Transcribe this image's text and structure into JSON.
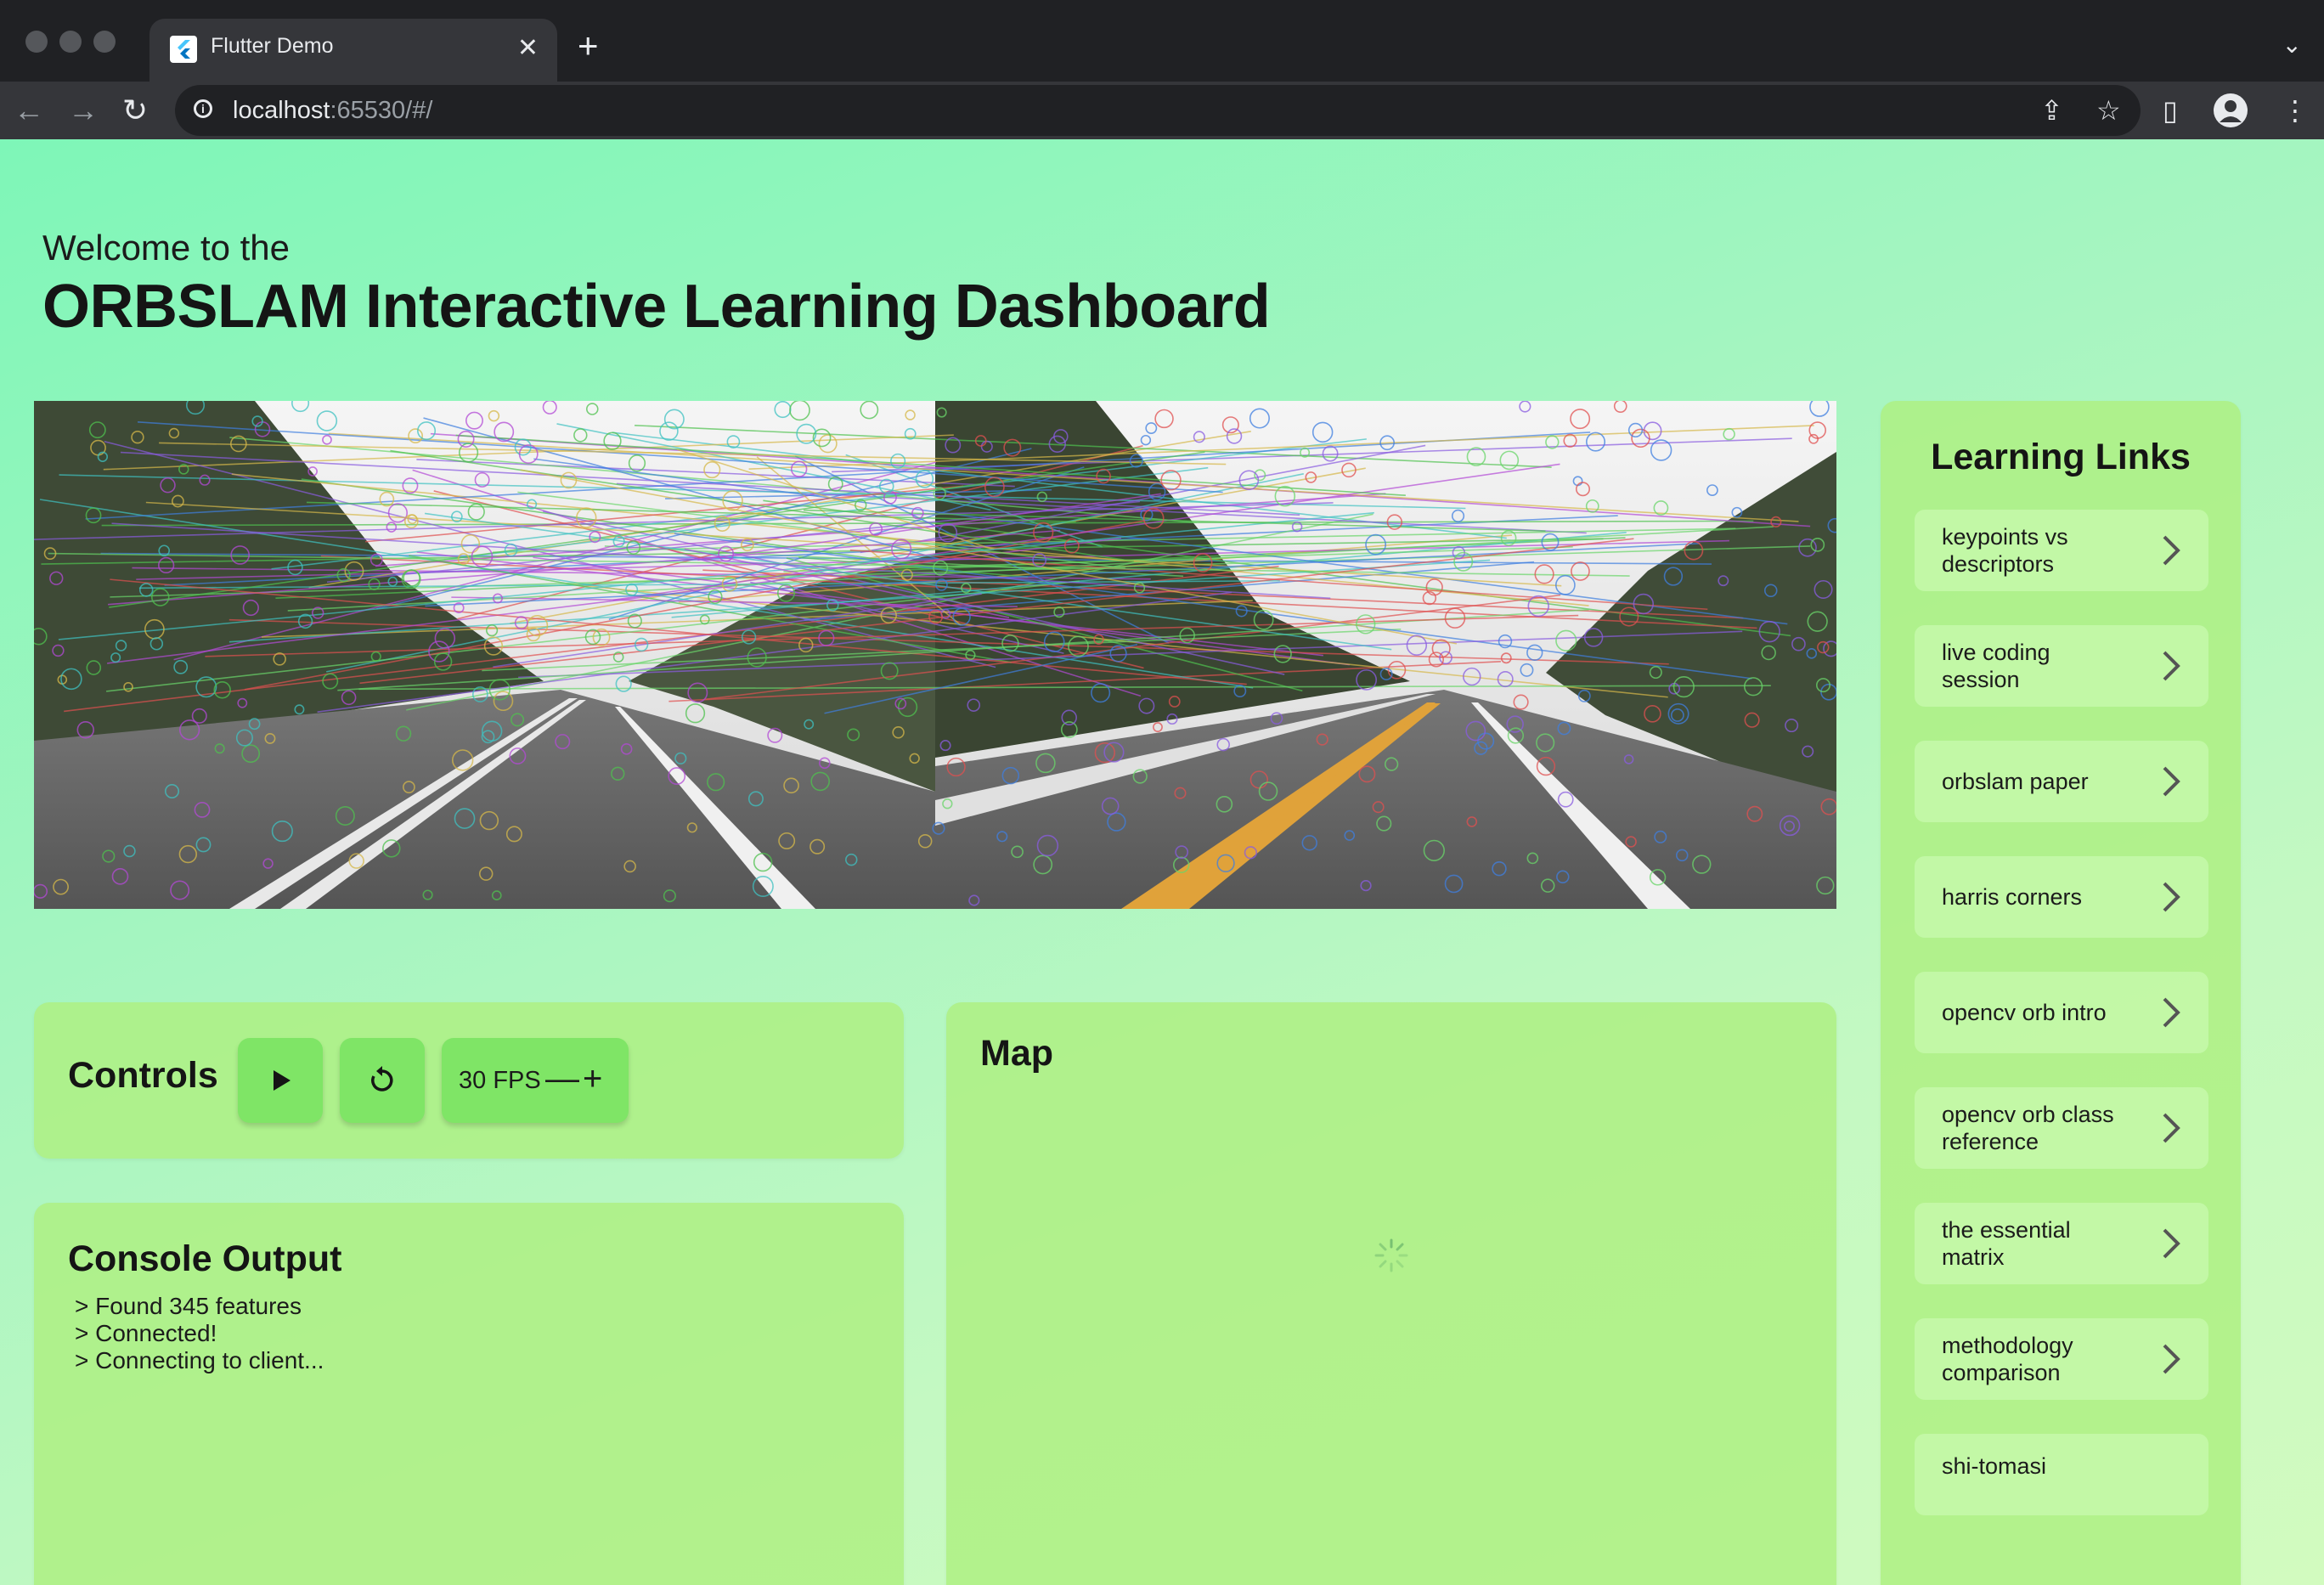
{
  "browser": {
    "tab_title": "Flutter Demo",
    "url_host": "localhost",
    "url_rest": ":65530/#/"
  },
  "header": {
    "welcome": "Welcome to the",
    "title": "ORBSLAM Interactive Learning Dashboard"
  },
  "controls": {
    "label": "Controls",
    "fps": "30 FPS",
    "minus": "—",
    "plus": "+"
  },
  "console": {
    "title": "Console Output",
    "lines": [
      "> Found 345 features",
      "> Connected!",
      "> Connecting to client..."
    ]
  },
  "map": {
    "title": "Map"
  },
  "learning_links": {
    "title": "Learning Links",
    "items": [
      {
        "label": "keypoints vs descriptors"
      },
      {
        "label": "live coding session"
      },
      {
        "label": "orbslam paper"
      },
      {
        "label": "harris corners"
      },
      {
        "label": "opencv orb intro"
      },
      {
        "label": "opencv orb class reference"
      },
      {
        "label": "the essential matrix"
      },
      {
        "label": "methodology comparison"
      },
      {
        "label": "shi-tomasi"
      }
    ]
  },
  "icons": {
    "play": "play-icon",
    "reset": "refresh-icon",
    "link_arrow": "chevron-right-icon"
  },
  "colors": {
    "page_gradient_start": "#7ef6b8",
    "page_gradient_end": "#d2fbbf",
    "card": "#aef082",
    "button": "#7fe566"
  }
}
